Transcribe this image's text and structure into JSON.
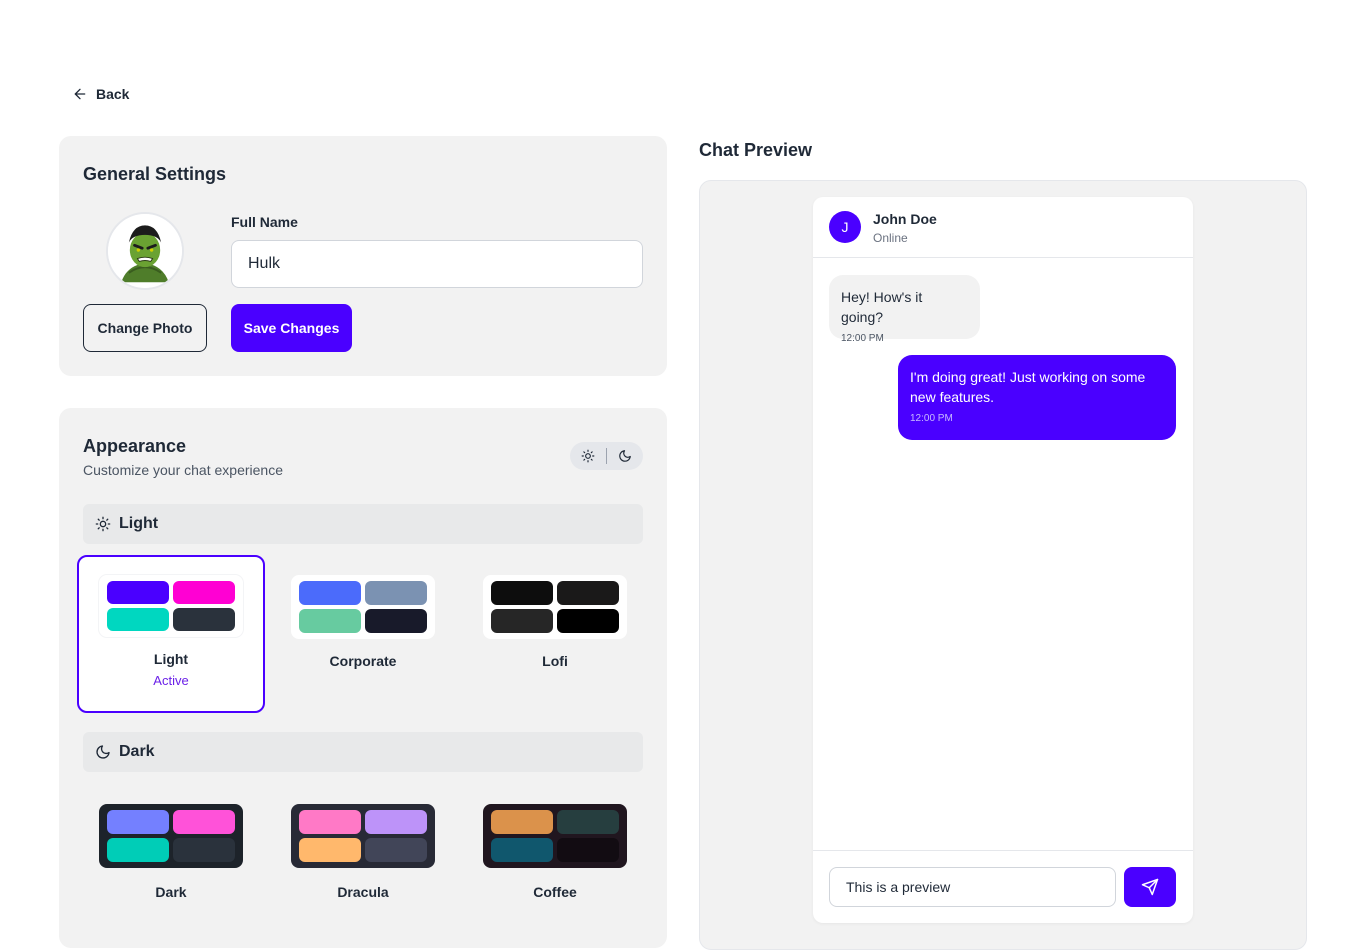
{
  "nav": {
    "back_label": "Back"
  },
  "general": {
    "title": "General Settings",
    "full_name_label": "Full Name",
    "full_name_value": "Hulk",
    "change_photo_label": "Change Photo",
    "save_label": "Save Changes"
  },
  "appearance": {
    "title": "Appearance",
    "subtitle": "Customize your chat experience",
    "light_section": "Light",
    "dark_section": "Dark",
    "active_label": "Active",
    "light_themes": [
      {
        "name": "Light",
        "active": true,
        "bg": "#ffffff",
        "colors": [
          "#4a00ff",
          "#ff00d3",
          "#00d7c0",
          "#2a323c"
        ]
      },
      {
        "name": "Corporate",
        "active": false,
        "bg": "#ffffff",
        "colors": [
          "#4b6bfb",
          "#7b92b2",
          "#67cba0",
          "#181a2a"
        ]
      },
      {
        "name": "Lofi",
        "active": false,
        "bg": "#ffffff",
        "colors": [
          "#0d0d0d",
          "#1a1919",
          "#262626",
          "#000000"
        ]
      }
    ],
    "dark_themes": [
      {
        "name": "Dark",
        "active": false,
        "bg": "#1d232a",
        "colors": [
          "#7480ff",
          "#ff52d9",
          "#00cdb7",
          "#2a323c"
        ]
      },
      {
        "name": "Dracula",
        "active": false,
        "bg": "#282a36",
        "colors": [
          "#ff79c6",
          "#bd93f9",
          "#ffb86c",
          "#414558"
        ]
      },
      {
        "name": "Coffee",
        "active": false,
        "bg": "#20161f",
        "colors": [
          "#db924b",
          "#263e3f",
          "#10576d",
          "#120c12"
        ]
      }
    ]
  },
  "preview": {
    "title": "Chat Preview",
    "contact_initial": "J",
    "contact_name": "John Doe",
    "contact_status": "Online",
    "messages": [
      {
        "text": "Hey! How's it going?",
        "time": "12:00 PM",
        "sent": false
      },
      {
        "text": "I'm doing great! Just working on some new features.",
        "time": "12:00 PM",
        "sent": true
      }
    ],
    "input_value": "This is a preview"
  },
  "colors": {
    "primary": "#4a00ff",
    "card_bg": "#f2f2f2"
  }
}
